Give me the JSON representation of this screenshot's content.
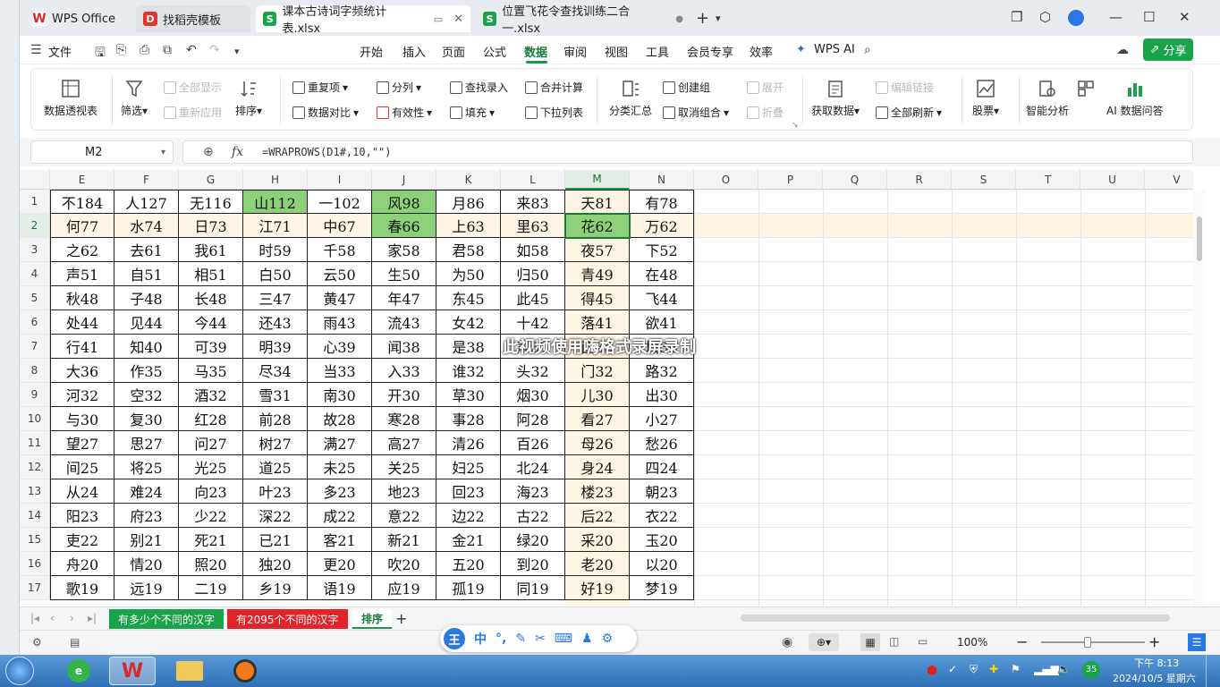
{
  "titlebar": {
    "tabs": [
      {
        "label": "WPS Office",
        "icon": "wps-logo-icon"
      },
      {
        "label": "找稻壳模板",
        "icon": "docer-icon"
      },
      {
        "label": "课本古诗词字频统计表.xlsx",
        "icon": "spreadsheet-icon"
      },
      {
        "label": "位置飞花令查找训练二合一.xlsx",
        "icon": "spreadsheet-icon"
      }
    ],
    "active_tab": 2
  },
  "menu": {
    "file_label": "文件",
    "items": [
      "开始",
      "插入",
      "页面",
      "公式",
      "数据",
      "审阅",
      "视图",
      "工具",
      "会员专享",
      "效率"
    ],
    "active": "数据",
    "wps_ai": "WPS AI",
    "share": "分享"
  },
  "ribbon": {
    "pivot": "数据透视表",
    "filter": "筛选",
    "show_all": "全部显示",
    "reapply": "重新应用",
    "sort": "排序",
    "duplicates": "重复项",
    "compare": "数据对比",
    "split": "分列",
    "validity": "有效性",
    "lookup_entry": "查找录入",
    "fill": "填充",
    "consolidate": "合并计算",
    "dropdown_list": "下拉列表",
    "subtotal": "分类汇总",
    "create_group": "创建组",
    "ungroup": "取消组合",
    "expand": "展开",
    "collapse": "折叠",
    "get_data": "获取数据",
    "edit_links": "编辑链接",
    "refresh_all": "全部刷新",
    "stocks": "股票",
    "smart_analysis": "智能分析",
    "ai_qa": "AI 数据问答"
  },
  "formula_bar": {
    "name_box": "M2",
    "fx": "fx",
    "formula": "=WRAPROWS(D1#,10,\"\")"
  },
  "grid": {
    "columns": [
      "E",
      "F",
      "G",
      "H",
      "I",
      "J",
      "K",
      "L",
      "M",
      "N",
      "O",
      "P",
      "Q",
      "R",
      "S",
      "T",
      "U",
      "V"
    ],
    "selected_column": "M",
    "selected_row": 2,
    "rows": [
      {
        "n": "1",
        "cells": [
          "不184",
          "人127",
          "无116",
          "山112",
          "一102",
          "风98",
          "月86",
          "来83",
          "天81",
          "有78"
        ]
      },
      {
        "n": "2",
        "cells": [
          "何77",
          "水74",
          "日73",
          "江71",
          "中67",
          "春66",
          "上63",
          "里63",
          "花62",
          "万62"
        ]
      },
      {
        "n": "3",
        "cells": [
          "之62",
          "去61",
          "我61",
          "时59",
          "千58",
          "家58",
          "君58",
          "如58",
          "夜57",
          "下52"
        ]
      },
      {
        "n": "4",
        "cells": [
          "声51",
          "自51",
          "相51",
          "白50",
          "云50",
          "生50",
          "为50",
          "归50",
          "青49",
          "在48"
        ]
      },
      {
        "n": "5",
        "cells": [
          "秋48",
          "子48",
          "长48",
          "三47",
          "黄47",
          "年47",
          "东45",
          "此45",
          "得45",
          "飞44"
        ]
      },
      {
        "n": "6",
        "cells": [
          "处44",
          "见44",
          "今44",
          "还43",
          "雨43",
          "流43",
          "女42",
          "十42",
          "落41",
          "欲41"
        ]
      },
      {
        "n": "7",
        "cells": [
          "行41",
          "知40",
          "可39",
          "明39",
          "心39",
          "闻38",
          "是38",
          "声37",
          "西36",
          "城36"
        ]
      },
      {
        "n": "8",
        "cells": [
          "大36",
          "作35",
          "马35",
          "尽34",
          "当33",
          "入33",
          "谁32",
          "头32",
          "门32",
          "路32"
        ]
      },
      {
        "n": "9",
        "cells": [
          "河32",
          "空32",
          "酒32",
          "雪31",
          "南30",
          "开30",
          "草30",
          "烟30",
          "儿30",
          "出30"
        ]
      },
      {
        "n": "10",
        "cells": [
          "与30",
          "复30",
          "红28",
          "前28",
          "故28",
          "寒28",
          "事28",
          "阿28",
          "看27",
          "小27"
        ]
      },
      {
        "n": "11",
        "cells": [
          "望27",
          "思27",
          "问27",
          "树27",
          "满27",
          "高27",
          "清26",
          "百26",
          "母26",
          "愁26"
        ]
      },
      {
        "n": "12",
        "cells": [
          "间25",
          "将25",
          "光25",
          "道25",
          "未25",
          "关25",
          "妇25",
          "北24",
          "身24",
          "四24"
        ]
      },
      {
        "n": "13",
        "cells": [
          "从24",
          "难24",
          "向23",
          "叶23",
          "多23",
          "地23",
          "回23",
          "海23",
          "楼23",
          "朝23"
        ]
      },
      {
        "n": "14",
        "cells": [
          "阳23",
          "府23",
          "少22",
          "深22",
          "成22",
          "意22",
          "边22",
          "古22",
          "后22",
          "衣22"
        ]
      },
      {
        "n": "15",
        "cells": [
          "吏22",
          "别21",
          "死21",
          "已21",
          "客21",
          "新21",
          "金21",
          "绿20",
          "采20",
          "玉20"
        ]
      },
      {
        "n": "16",
        "cells": [
          "舟20",
          "情20",
          "照20",
          "独20",
          "更20",
          "吹20",
          "五20",
          "到20",
          "老20",
          "以20"
        ]
      },
      {
        "n": "17",
        "cells": [
          "歌19",
          "远19",
          "二19",
          "乡19",
          "语19",
          "应19",
          "孤19",
          "同19",
          "好19",
          "梦19"
        ]
      }
    ],
    "green_cells": [
      "H1",
      "J1",
      "J2",
      "M2"
    ],
    "watermark": "此视频使用嗨格式录屏录制"
  },
  "sheets": [
    {
      "label": "有多少个不同的汉字",
      "color": "#1aa34a"
    },
    {
      "label": "有2095个不同的汉字",
      "color": "#e0242a"
    },
    {
      "label": "排序",
      "color": "active"
    }
  ],
  "status": {
    "zoom": "100%",
    "ime_label": "中"
  },
  "taskbar": {
    "time": "下午 8:13",
    "date": "2024/10/5 星期六",
    "badge": "35"
  },
  "colors": {
    "accent": "#1a7a3b",
    "green_fill": "#8cd07a",
    "highlight": "#fdf4e3"
  }
}
